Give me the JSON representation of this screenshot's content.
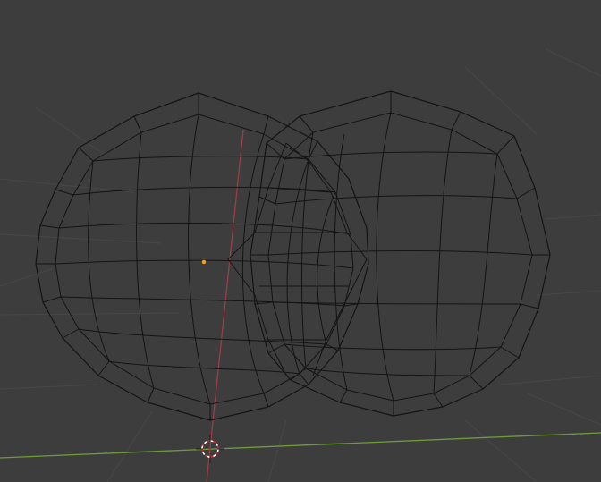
{
  "app": "3D Viewport",
  "view": {
    "mode": "wireframe",
    "background_color": "#3d3d3d",
    "grid_color": "#474747"
  },
  "axes": {
    "x_axis_color": "#6e9b3c",
    "y_axis_color": "#9b3c48"
  },
  "scene": {
    "objects": [
      {
        "name": "mesh-sphere-left",
        "shape": "rounded-cube-sphere",
        "wire_color": "#141414"
      },
      {
        "name": "mesh-sphere-right",
        "shape": "rounded-cube-sphere",
        "wire_color": "#141414"
      }
    ],
    "origin_point_color": "#f0a020",
    "cursor": {
      "icon": "3d-cursor-icon",
      "colors": [
        "#ffffff",
        "#cc2b2b"
      ]
    }
  }
}
